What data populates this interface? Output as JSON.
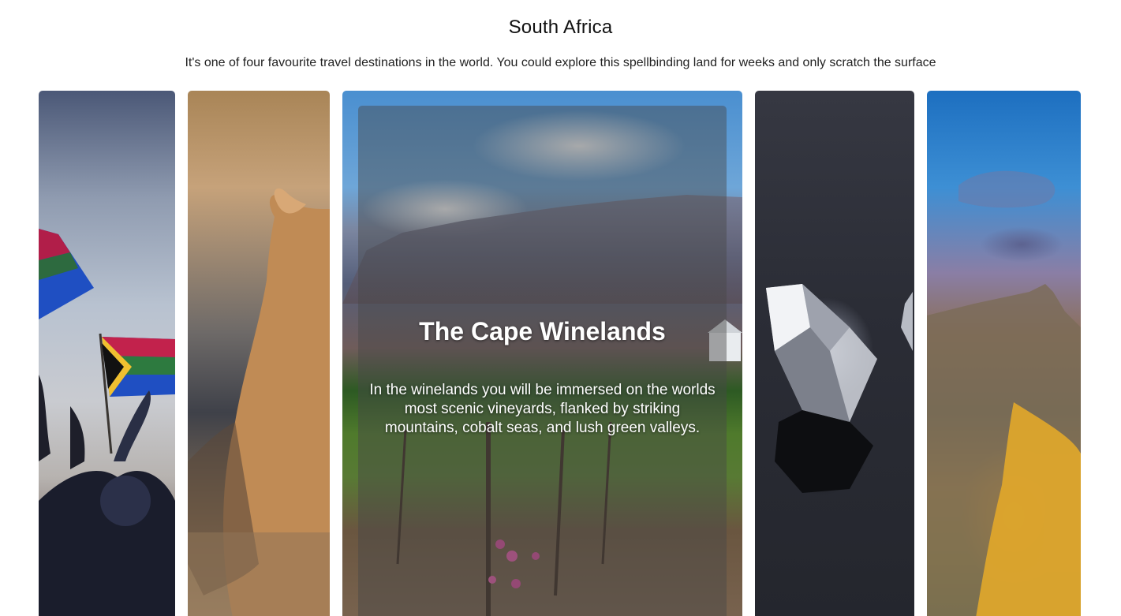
{
  "header": {
    "title": "South Africa",
    "subtitle": "It's one of four favourite travel destinations in the world. You could explore this spellbinding land for weeks and only scratch the surface"
  },
  "cards": [
    {
      "name": "flags-crowd",
      "image": "people-waving-south-african-flags"
    },
    {
      "name": "lioness",
      "image": "lioness"
    },
    {
      "name": "cape-winelands",
      "image": "vineyard-and-mountains",
      "active": true,
      "title": "The Cape Winelands",
      "description": "In the winelands you will be immersed on the worlds most scenic vineyards, flanked by striking mountains, cobalt seas, and lush green valleys."
    },
    {
      "name": "diamonds",
      "image": "diamonds"
    },
    {
      "name": "table-mountain",
      "image": "table-mountain-sunset"
    }
  ]
}
